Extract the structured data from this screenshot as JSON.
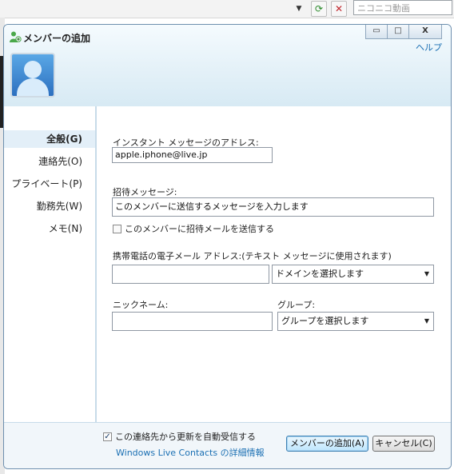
{
  "browser": {
    "search_placeholder": "ニコニコ動画",
    "drop_glyph": "▼",
    "refresh_glyph": "⟳",
    "stop_glyph": "✕"
  },
  "dialog": {
    "title": "メンバーの追加",
    "help": "ヘルプ",
    "controls": {
      "minimize": "▭",
      "maximize": "□",
      "close": "X"
    }
  },
  "nav": {
    "items": [
      {
        "label": "全般(G)",
        "active": true
      },
      {
        "label": "連絡先(O)",
        "active": false
      },
      {
        "label": "プライベート(P)",
        "active": false
      },
      {
        "label": "勤務先(W)",
        "active": false
      },
      {
        "label": "メモ(N)",
        "active": false
      }
    ]
  },
  "form": {
    "im_address_label": "インスタント メッセージのアドレス:",
    "im_address_value": "apple.iphone@live.jp",
    "invite_label": "招待メッセージ:",
    "invite_value": "このメンバーに送信するメッセージを入力します",
    "send_invite_label": "このメンバーに招待メールを送信する",
    "send_invite_checked": false,
    "mobile_label": "携帯電話の電子メール アドレス:(テキスト メッセージに使用されます)",
    "mobile_value": "",
    "domain_select": "ドメインを選択します",
    "nickname_label": "ニックネーム:",
    "nickname_value": "",
    "group_label": "グループ:",
    "group_select": "グループを選択します"
  },
  "footer": {
    "auto_update_label": "この連絡先から更新を自動受信する",
    "auto_update_checked": true,
    "details_link": "Windows Live Contacts の詳細情報",
    "add_button": "メンバーの追加(A)",
    "cancel_button": "キャンセル(C)"
  },
  "colors": {
    "link": "#1a6fb3",
    "nav_active_bg": "#e3eff8",
    "header_gradient_top": "#f5fbfe",
    "header_gradient_bottom": "#d7eaf4"
  }
}
